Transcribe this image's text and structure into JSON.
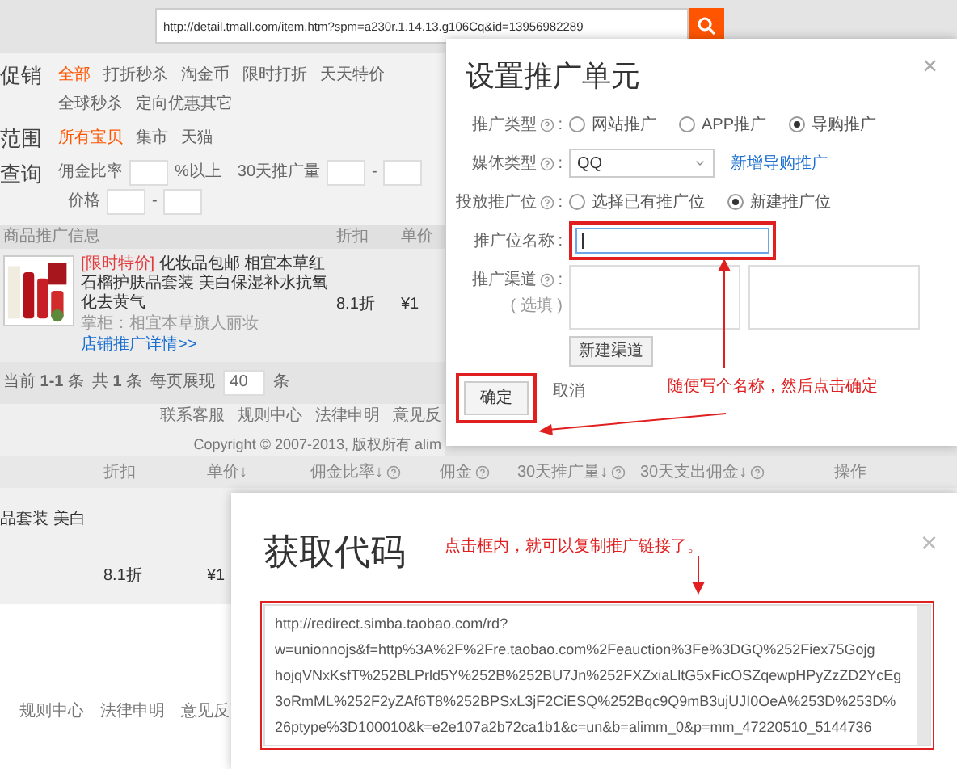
{
  "url_bar": {
    "value": "http://detail.tmall.com/item.htm?spm=a230r.1.14.13.g106Cq&id=13956982289"
  },
  "filters": [
    {
      "label": "促销",
      "options": [
        {
          "label": "全部",
          "selected": true
        },
        {
          "label": "打折秒杀",
          "selected": false
        },
        {
          "label": "淘金币",
          "selected": false
        },
        {
          "label": "限时打折",
          "selected": false
        },
        {
          "label": "天天特价",
          "selected": false
        },
        {
          "label": "全球秒杀",
          "selected": false
        },
        {
          "label": "定向优惠其它",
          "selected": false
        }
      ]
    },
    {
      "label": "范围",
      "options": [
        {
          "label": "所有宝贝",
          "selected": true
        },
        {
          "label": "集市",
          "selected": false
        },
        {
          "label": "天猫",
          "selected": false
        }
      ]
    }
  ],
  "query": {
    "label": "查询",
    "commission_label": "佣金比率",
    "commission_suffix": "%以上",
    "volume_label": "30天推广量",
    "volume_dash": "-",
    "price_label": "价格",
    "price_dash": "-"
  },
  "table": {
    "columns": [
      "商品推广信息",
      "折扣",
      "单价"
    ],
    "rows": [
      {
        "tag": "[限时特价]",
        "title": "化妆品包邮 相宜本草红石榴护肤品套装 美白保湿补水抗氧化去黄气",
        "seller": "掌柜：相宜本草旗人丽妆",
        "link": "店铺推广详情>>",
        "discount": "8.1折",
        "price": "¥1"
      }
    ]
  },
  "pagination": {
    "current": "当前 **1-1** 条",
    "total": "共 **1** 条",
    "per_page_label": "每页展现",
    "per_page": "40",
    "unit": "条"
  },
  "footer": {
    "links": [
      "联系客服",
      "规则中心",
      "法律申明",
      "意见反"
    ],
    "copyright": "Copyright © 2007-2013, 版权所有 alim"
  },
  "unit_dialog": {
    "title": "设置推广单元",
    "close": "×",
    "fields": [
      {
        "kind": "radio",
        "label": "推广类型",
        "help": true,
        "colon": ":",
        "options": [
          {
            "label": "网站推广",
            "selected": false
          },
          {
            "label": "APP推广",
            "selected": false
          },
          {
            "label": "导购推广",
            "selected": true
          }
        ]
      },
      {
        "kind": "select",
        "label": "媒体类型",
        "help": true,
        "colon": ":",
        "value": "QQ",
        "link": "新增导购推广"
      },
      {
        "kind": "radio",
        "label": "投放推广位",
        "help": true,
        "colon": ":",
        "options": [
          {
            "label": "选择已有推广位",
            "selected": false
          },
          {
            "label": "新建推广位",
            "selected": true
          }
        ]
      },
      {
        "kind": "input",
        "label": "推广位名称",
        "help": false,
        "colon": ":",
        "focused": true
      },
      {
        "kind": "channels",
        "label": "推广渠道",
        "help": true,
        "colon": ":",
        "hint": "( 选填 )",
        "button": "新建渠道"
      }
    ],
    "note": "随便写个名称，然后点击确定",
    "confirm": "确定",
    "cancel": "取消"
  },
  "lower_table": {
    "columns": [
      {
        "label": "折扣",
        "help": false
      },
      {
        "label": "单价↓",
        "help": false
      },
      {
        "label": "佣金比率↓",
        "help": true
      },
      {
        "label": "佣金",
        "help": true
      },
      {
        "label": "30天推广量↓",
        "help": true
      },
      {
        "label": "30天支出佣金↓",
        "help": true
      },
      {
        "label": "操作",
        "help": false
      }
    ],
    "row": {
      "title": "品套装 美白",
      "discount": "8.1折",
      "price": "¥1"
    }
  },
  "lower_footer": [
    "规则中心",
    "法律申明",
    "意见反"
  ],
  "code_dialog": {
    "title": "获取代码",
    "close": "×",
    "note": "点击框内，就可以复制推广链接了。",
    "code_lines": [
      "http://redirect.simba.taobao.com/rd?",
      "w=unionnojs&f=http%3A%2F%2Fre.taobao.com%2Feauction%3Fe%3DGQ%252Fiex75Gojg",
      "hojqVNxKsfT%252BLPrld5Y%252B%252BU7Jn%252FXZxiaLltG5xFicOSZqewpHPyZzZD2YcEg",
      "3oRmML%252F2yZAf6T8%252BPSxL3jF2CiESQ%252Bqc9Q9mB3ujUJI0OeA%253D%253D%",
      "26ptype%3D100010&k=e2e107a2b72ca1b1&c=un&b=alimm_0&p=mm_47220510_5144736"
    ]
  }
}
